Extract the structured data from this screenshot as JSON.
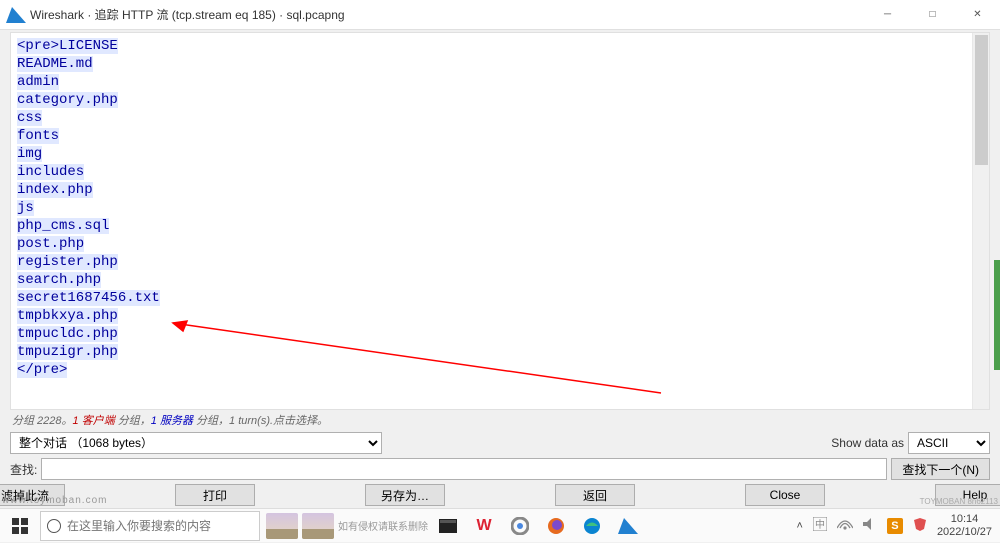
{
  "window": {
    "title": "Wireshark · 追踪 HTTP 流 (tcp.stream eq 185) · sql.pcapng"
  },
  "http_lines": [
    "<pre>LICENSE",
    "README.md",
    "admin",
    "category.php",
    "css",
    "fonts",
    "img",
    "includes",
    "index.php",
    "js",
    "php_cms.sql",
    "post.php",
    "register.php",
    "search.php",
    "secret1687456.txt",
    "tmpbkxya.php",
    "tmpucldc.php",
    "tmpuzigr.php",
    "</pre>"
  ],
  "stats": {
    "prefix": "分组 2228。",
    "client_label": "1 客户端",
    "mid1": " 分组，",
    "server_label": "1 服务器",
    "suffix": " 分组，1 turn(s).点击选择。"
  },
  "conversation_select": "整个对话 （1068 bytes）",
  "show_data_as_label": "Show data as",
  "encoding_select": "ASCII",
  "find_label": "查找:",
  "find_value": "",
  "find_next_btn": "查找下一个(N)",
  "buttons": {
    "filter_stream": "滤掉此流",
    "print": "打印",
    "save_as": "另存为…",
    "back": "返回",
    "close": "Close",
    "help": "Help"
  },
  "taskbar": {
    "search_placeholder": "在这里输入你要搜索的内容",
    "clock_time": "10:14",
    "clock_date": "2022/10/27"
  },
  "watermark_left": "www.toymoban.com",
  "watermark_right": "TOYMOBAN 8n62113",
  "watermark_mid": "如有侵权请联系删除"
}
